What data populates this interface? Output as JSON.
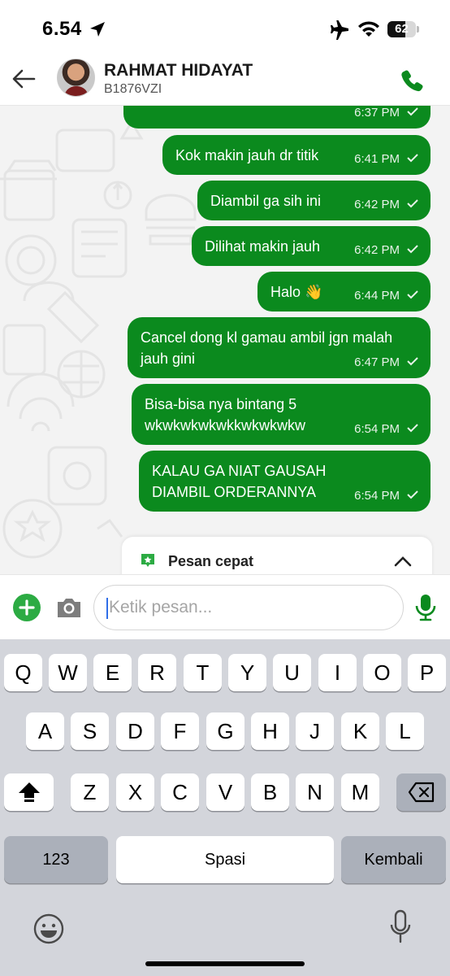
{
  "status_bar": {
    "time": "6.54",
    "battery": "62",
    "battery_level": 0.62
  },
  "header": {
    "contact_name": "RAHMAT HIDAYAT",
    "contact_subtitle": "B1876VZI"
  },
  "messages": [
    {
      "text": "",
      "time": "6:37 PM"
    },
    {
      "text": "Kok makin jauh dr titik",
      "time": "6:41 PM"
    },
    {
      "text": "Diambil ga sih ini",
      "time": "6:42 PM"
    },
    {
      "text": "Dilihat makin jauh",
      "time": "6:42 PM"
    },
    {
      "text": "Halo 👋",
      "time": "6:44 PM"
    },
    {
      "text": "Cancel dong kl gamau ambil jgn malah jauh gini",
      "time": "6:47 PM"
    },
    {
      "text": "Bisa-bisa nya bintang 5 wkwkwkwkwkkwkwkwkw",
      "time": "6:54 PM"
    },
    {
      "text": "KALAU GA NIAT GAUSAH DIAMBIL ORDERANNYA",
      "time": "6:54 PM"
    }
  ],
  "quick_reply": {
    "label": "Pesan cepat"
  },
  "input": {
    "placeholder": "Ketik pesan..."
  },
  "keyboard": {
    "row1": [
      "Q",
      "W",
      "E",
      "R",
      "T",
      "Y",
      "U",
      "I",
      "O",
      "P"
    ],
    "row2": [
      "A",
      "S",
      "D",
      "F",
      "G",
      "H",
      "J",
      "K",
      "L"
    ],
    "row3": [
      "Z",
      "X",
      "C",
      "V",
      "B",
      "N",
      "M"
    ],
    "numbers_key": "123",
    "space_key": "Spasi",
    "return_key": "Kembali"
  },
  "colors": {
    "bubble": "#0b8a1e",
    "accent": "#2cab43",
    "keyboard_bg": "#d3d5db"
  },
  "icons": {
    "back": "arrow-left-icon",
    "call": "phone-icon",
    "add": "plus-icon",
    "camera": "camera-icon",
    "mic": "microphone-icon",
    "shift": "shift-icon",
    "backspace": "backspace-icon",
    "emoji": "emoji-icon",
    "dictation": "dictation-mic-icon"
  }
}
